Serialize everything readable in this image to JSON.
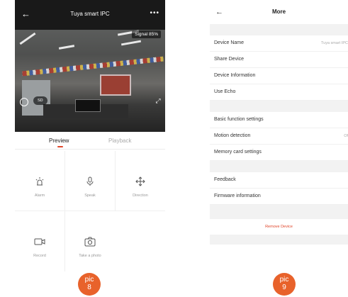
{
  "left_screen": {
    "header": {
      "back_icon": "back-arrow-icon",
      "title": "Tuya smart IPC",
      "more": "•••"
    },
    "video": {
      "signal": "Signal 85%",
      "quality": "SD"
    },
    "tabs": [
      {
        "label": "Preview",
        "active": true
      },
      {
        "label": "Playback",
        "active": false
      }
    ],
    "grid": [
      {
        "label": "Alarm",
        "icon": "alarm-icon"
      },
      {
        "label": "Speak",
        "icon": "microphone-icon"
      },
      {
        "label": "Direction",
        "icon": "direction-icon"
      },
      {
        "label": "Record",
        "icon": "record-icon"
      },
      {
        "label": "Take a photo",
        "icon": "camera-icon"
      }
    ]
  },
  "right_screen": {
    "header": {
      "title": "More"
    },
    "rows": [
      {
        "label": "Device Name",
        "value": "Tuya smart IPC"
      },
      {
        "label": "Share Device",
        "value": ""
      },
      {
        "label": "Device Information",
        "value": ""
      },
      {
        "label": "Use Echo",
        "value": ""
      },
      {
        "label": "Basic function settings",
        "value": ""
      },
      {
        "label": "Motion detection",
        "value": "Of"
      },
      {
        "label": "Memory card settings",
        "value": ""
      },
      {
        "label": "Feedback",
        "value": ""
      },
      {
        "label": "Firmware information",
        "value": ""
      }
    ],
    "remove_device": "Remove Device"
  },
  "badges": [
    {
      "line1": "pic",
      "line2": "8"
    },
    {
      "line1": "pic",
      "line2": "9"
    }
  ],
  "colors": {
    "accent": "#e0452a",
    "badge": "#e8622b",
    "header_dark": "#191919"
  }
}
